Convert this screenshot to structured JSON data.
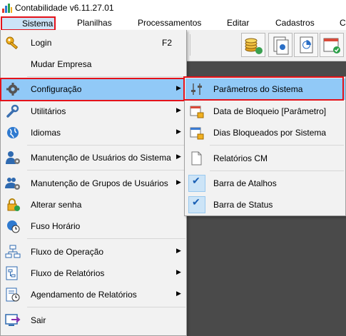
{
  "window": {
    "title": "Contabilidade v6.11.27.01",
    "icon": "bar-chart-app-icon"
  },
  "menubar": {
    "items": [
      {
        "label": "Sistema",
        "active": true
      },
      {
        "label": "Planilhas"
      },
      {
        "label": "Processamentos"
      },
      {
        "label": "Editar"
      },
      {
        "label": "Cadastros"
      },
      {
        "label": "C"
      }
    ]
  },
  "toolbar": {
    "buttons": [
      "coins-refresh-icon",
      "documents-icon",
      "report-chart-icon",
      "calendar-check-icon"
    ]
  },
  "main_menu": {
    "items": [
      {
        "label": "Login",
        "shortcut": "F2",
        "icon": "key-icon"
      },
      {
        "label": "Mudar Empresa",
        "icon": "none"
      },
      {
        "label": "Configuração",
        "icon": "gear-icon",
        "submenu": true,
        "highlighted": true
      },
      {
        "label": "Utilitários",
        "icon": "wrench-icon",
        "submenu": true
      },
      {
        "label": "Idiomas",
        "icon": "globe-icon",
        "submenu": true
      },
      {
        "label": "Manutenção de Usuários do Sistema",
        "icon": "user-gear-icon",
        "submenu": true
      },
      {
        "label": "Manutenção de Grupos de Usuários",
        "icon": "users-gear-icon",
        "submenu": true
      },
      {
        "label": "Alterar senha",
        "icon": "lock-refresh-icon"
      },
      {
        "label": "Fuso Horário",
        "icon": "globe-clock-icon"
      },
      {
        "label": "Fluxo de Operação",
        "icon": "flowchart-icon",
        "submenu": true
      },
      {
        "label": "Fluxo de Relatórios",
        "icon": "report-flow-icon",
        "submenu": true
      },
      {
        "label": "Agendamento de Relatórios",
        "icon": "report-clock-icon",
        "submenu": true
      },
      {
        "label": "Sair",
        "icon": "exit-icon"
      }
    ]
  },
  "sub_menu": {
    "items": [
      {
        "label": "Parâmetros do Sistema",
        "icon": "sliders-icon",
        "highlighted": true
      },
      {
        "label": "Data de Bloqueio [Parâmetro]",
        "icon": "calendar-lock-icon"
      },
      {
        "label": "Dias Bloqueados por Sistema",
        "icon": "calendar-lock-icon"
      },
      {
        "label": "Relatórios CM",
        "icon": "document-icon"
      },
      {
        "label": "Barra de Atalhos",
        "icon": "checkmark-icon",
        "checked": true
      },
      {
        "label": "Barra de Status",
        "icon": "checkmark-icon",
        "checked": true
      }
    ]
  },
  "colors": {
    "highlight": "#91c9f7",
    "annotation_red": "#e4121a",
    "menu_bg": "#f2f2f2"
  }
}
